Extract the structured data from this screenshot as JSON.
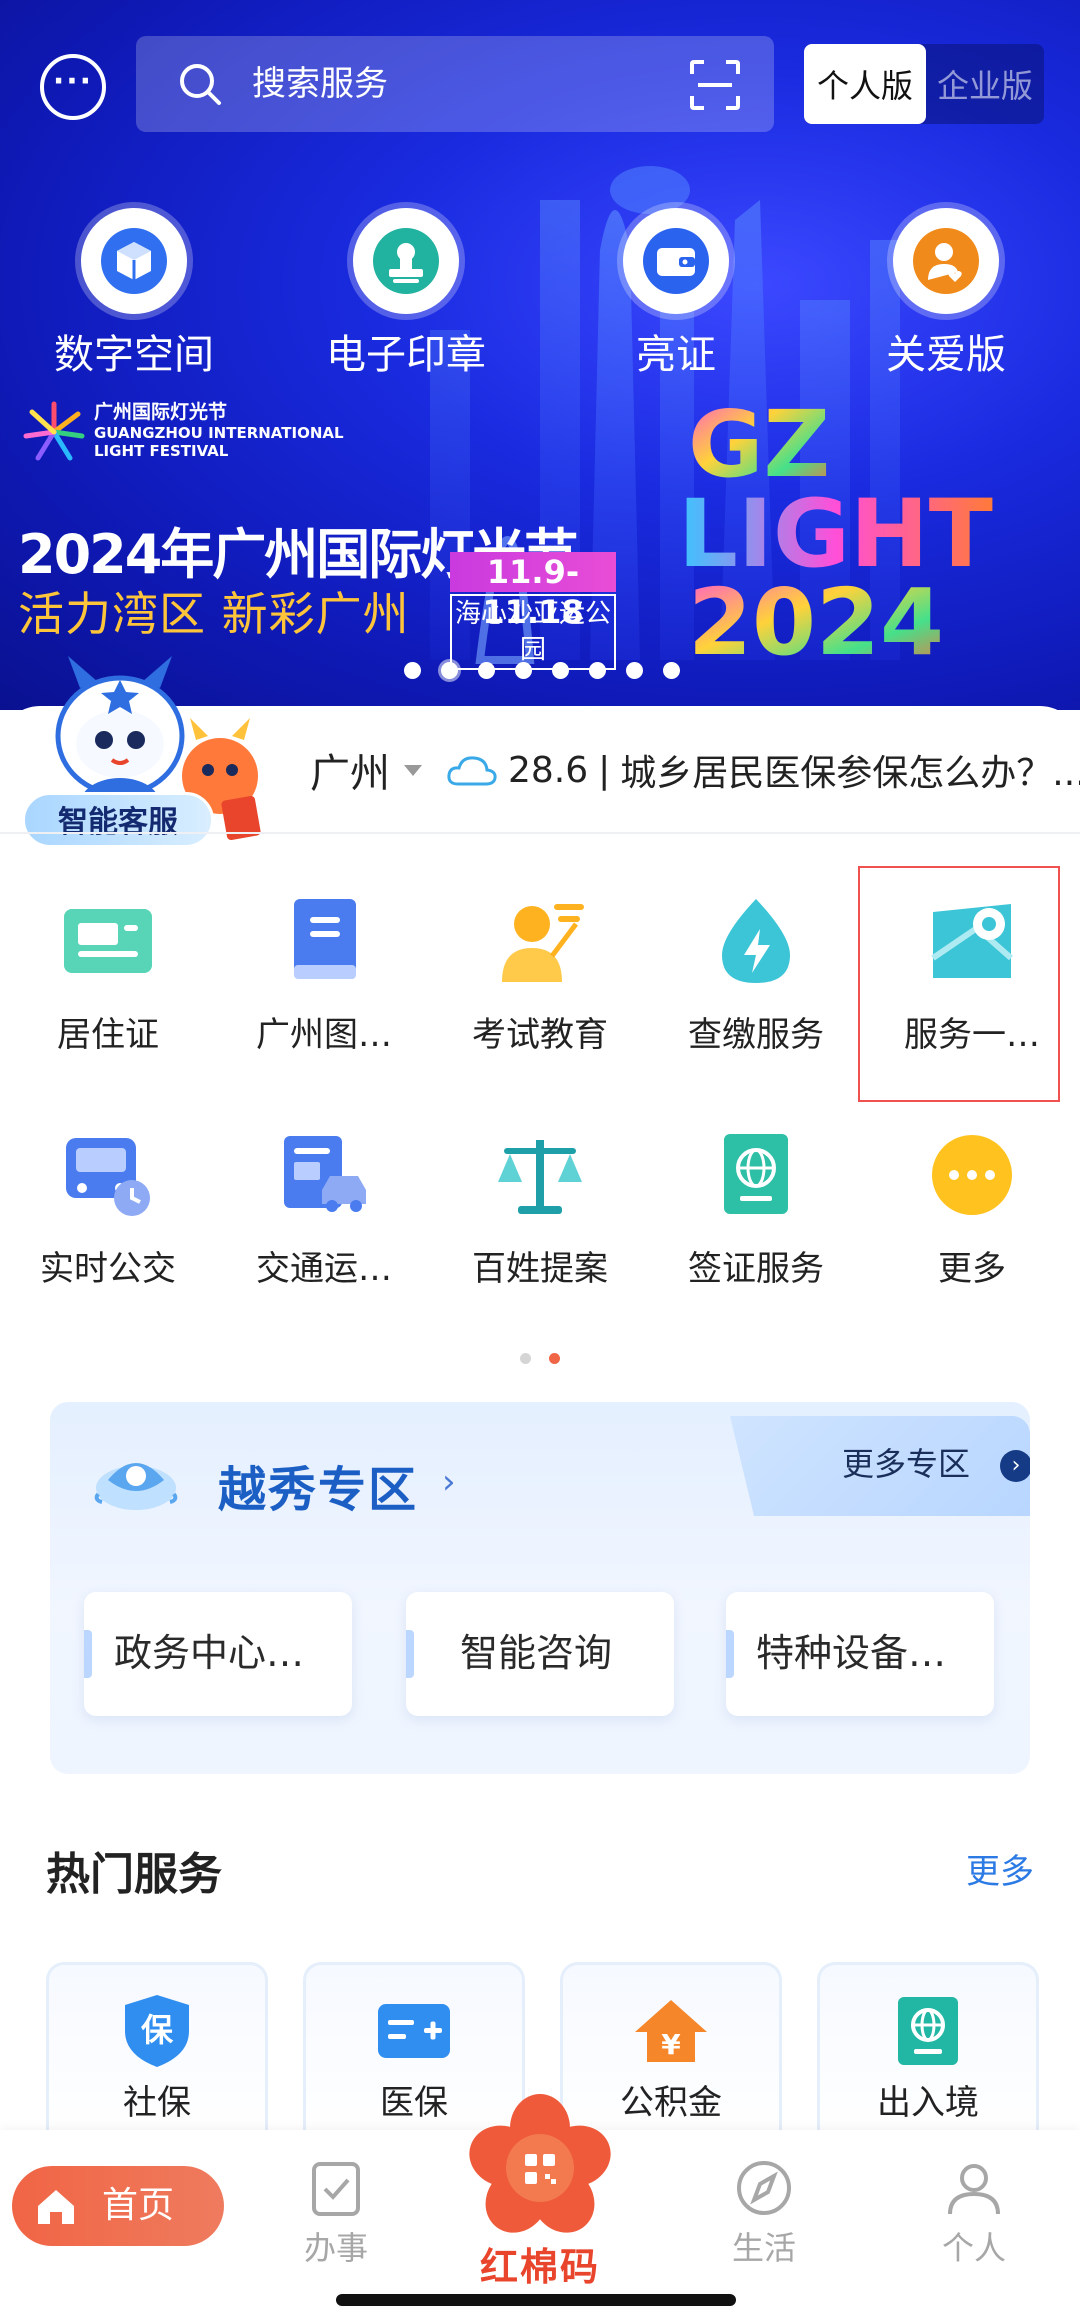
{
  "header": {
    "search_placeholder": "搜索服务",
    "version_personal": "个人版",
    "version_enterprise": "企业版"
  },
  "quick_actions": [
    {
      "label": "数字空间",
      "icon": "cube-icon"
    },
    {
      "label": "电子印章",
      "icon": "stamp-icon"
    },
    {
      "label": "亮证",
      "icon": "wallet-icon"
    },
    {
      "label": "关爱版",
      "icon": "care-person-icon"
    }
  ],
  "banner": {
    "festival_name_cn": "广州国际灯光节",
    "festival_name_en": "GUANGZHOU INTERNATIONAL LIGHT FESTIVAL",
    "title": "2024年广州国际灯光节",
    "slogan": "活力湾区  新彩广州",
    "date": "11.9-11.18",
    "venue": "海心沙亚运公园",
    "light_logo_text": "GZ LIGHT 2024",
    "slide_count": 8,
    "active_slide": 1
  },
  "assistant": {
    "label": "智能客服"
  },
  "info_bar": {
    "city": "广州",
    "temperature": "28.6",
    "divider": "|",
    "news": "城乡居民医保参保怎么办？..."
  },
  "service_grid": [
    {
      "label": "居住证",
      "icon": "residence-card-icon"
    },
    {
      "label": "广州图…",
      "icon": "library-book-icon"
    },
    {
      "label": "考试教育",
      "icon": "exam-teacher-icon"
    },
    {
      "label": "查缴服务",
      "icon": "payment-bolt-icon"
    },
    {
      "label": "服务一…",
      "icon": "map-pin-icon"
    },
    {
      "label": "实时公交",
      "icon": "bus-clock-icon"
    },
    {
      "label": "交通运…",
      "icon": "traffic-fine-icon"
    },
    {
      "label": "百姓提案",
      "icon": "scale-icon"
    },
    {
      "label": "签证服务",
      "icon": "passport-icon"
    },
    {
      "label": "更多",
      "icon": "more-dots-icon"
    }
  ],
  "grid_page_dots": {
    "count": 2,
    "active": 1
  },
  "district": {
    "title": "越秀专区",
    "more_label": "更多专区",
    "cards": [
      "政务中心…",
      "智能咨询",
      "特种设备…"
    ]
  },
  "hot_services": {
    "title": "热门服务",
    "more": "更多",
    "items": [
      {
        "label": "社保",
        "icon": "social-security-icon"
      },
      {
        "label": "医保",
        "icon": "medical-card-icon"
      },
      {
        "label": "公积金",
        "icon": "housing-fund-icon"
      },
      {
        "label": "出入境",
        "icon": "globe-passport-icon"
      }
    ]
  },
  "bottom_nav": {
    "home": "首页",
    "affairs": "办事",
    "center": "红棉码",
    "life": "生活",
    "personal": "个人"
  },
  "colors": {
    "banner_blue": "#1a2be0",
    "accent_orange": "#f06545",
    "link_blue": "#2c7be5",
    "highlight_red": "#f05050",
    "district_title": "#1c5fc4"
  }
}
